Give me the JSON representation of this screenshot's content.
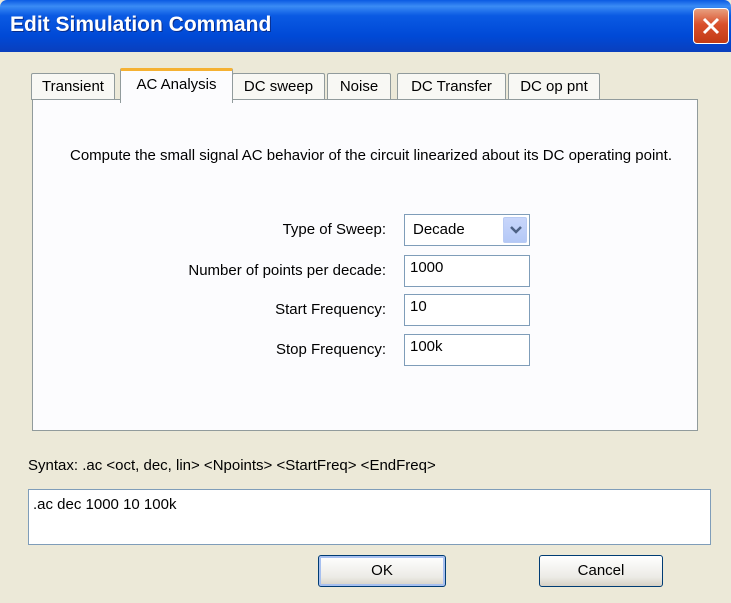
{
  "window": {
    "title": "Edit Simulation Command"
  },
  "tabs": [
    {
      "label": "Transient"
    },
    {
      "label": "AC Analysis"
    },
    {
      "label": "DC sweep"
    },
    {
      "label": "Noise"
    },
    {
      "label": "DC Transfer"
    },
    {
      "label": "DC op pnt"
    }
  ],
  "active_tab": "AC Analysis",
  "panel": {
    "description": "Compute the small signal AC behavior of the circuit linearized about its DC operating point.",
    "sweep_type": {
      "label": "Type of Sweep:",
      "value": "Decade"
    },
    "points": {
      "label": "Number of points per decade:",
      "value": "1000"
    },
    "start_freq": {
      "label": "Start Frequency:",
      "value": "10"
    },
    "stop_freq": {
      "label": "Stop Frequency:",
      "value": "100k"
    }
  },
  "syntax": "Syntax:  .ac <oct, dec, lin> <Npoints> <StartFreq> <EndFreq>",
  "command_text": ".ac dec 1000 10 100k",
  "buttons": {
    "ok": "OK",
    "cancel": "Cancel"
  },
  "colors": {
    "titlebar": "#0a5ae3",
    "close": "#d9502c",
    "active_tab_accent": "#f5b133"
  }
}
